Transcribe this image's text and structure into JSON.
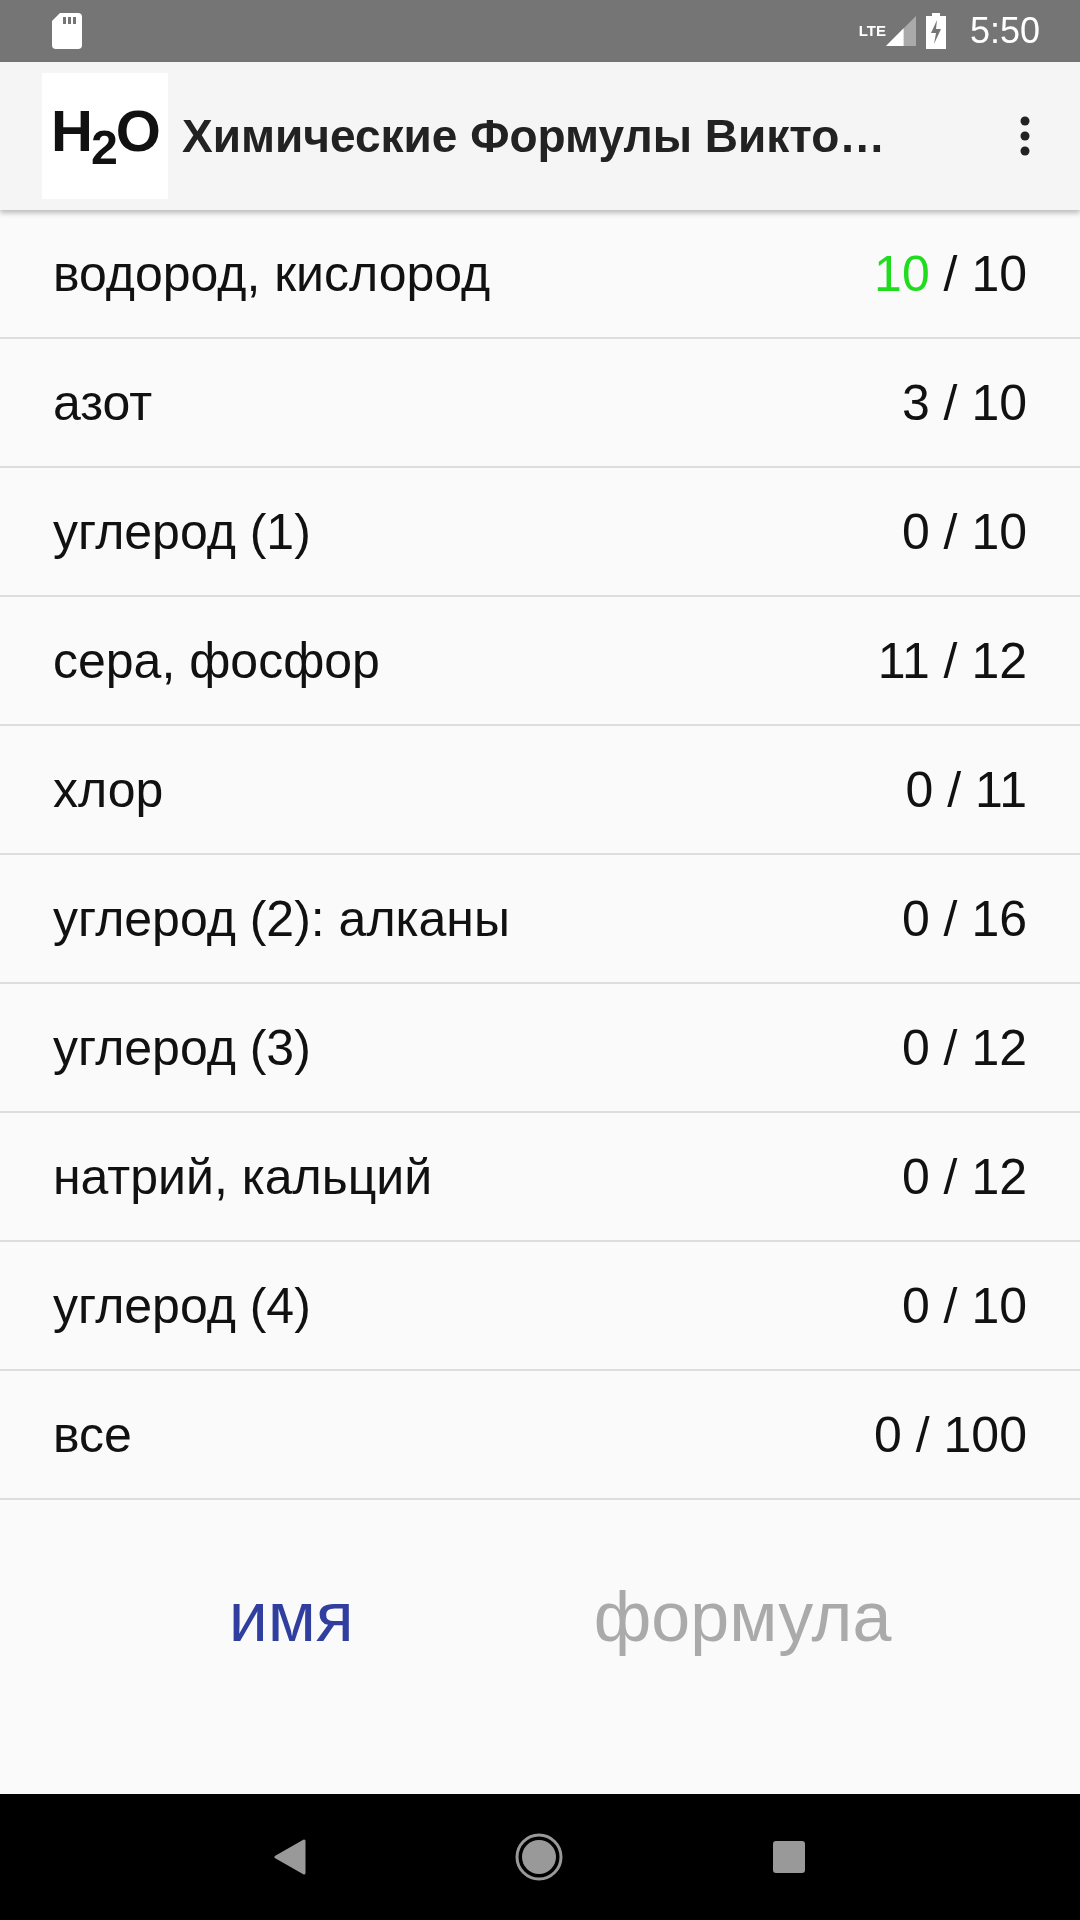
{
  "status_bar": {
    "network": "LTE",
    "time": "5:50"
  },
  "app_bar": {
    "logo": "H$_{2}$O",
    "title": "Химические Формулы Викто…"
  },
  "topics": [
    {
      "name": "водород, кислород",
      "solved": "10",
      "total": "/ 10",
      "complete": true
    },
    {
      "name": "азот",
      "solved": "3",
      "total": "/ 10",
      "complete": false
    },
    {
      "name": "углерод (1)",
      "solved": "0",
      "total": "/ 10",
      "complete": false
    },
    {
      "name": "сера, фосфор",
      "solved": "11",
      "total": "/ 12",
      "complete": false
    },
    {
      "name": "хлор",
      "solved": "0",
      "total": "/ 11",
      "complete": false
    },
    {
      "name": "углерод (2): алканы",
      "solved": "0",
      "total": "/ 16",
      "complete": false
    },
    {
      "name": "углерод (3)",
      "solved": "0",
      "total": "/ 12",
      "complete": false
    },
    {
      "name": "натрий, кальций",
      "solved": "0",
      "total": "/ 12",
      "complete": false
    },
    {
      "name": "углерод (4)",
      "solved": "0",
      "total": "/ 10",
      "complete": false
    },
    {
      "name": "все",
      "solved": "0",
      "total": "/ 100",
      "complete": false
    }
  ],
  "mode_toggle": [
    {
      "label": "имя",
      "selected": true
    },
    {
      "label": "формула",
      "selected": false
    }
  ]
}
